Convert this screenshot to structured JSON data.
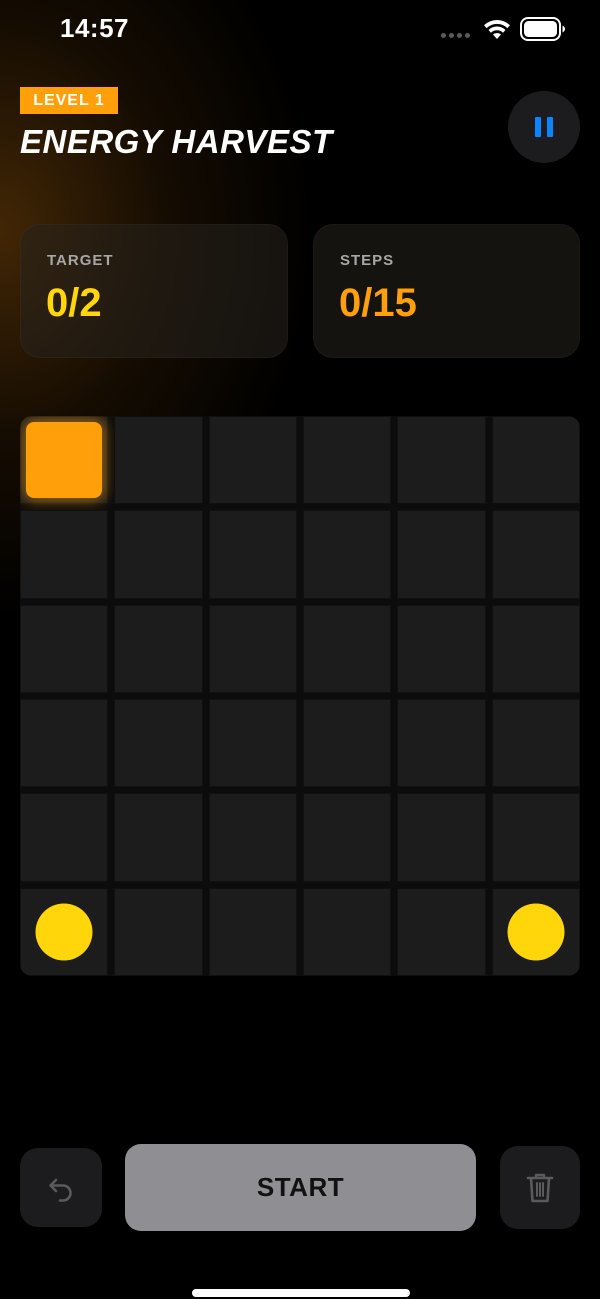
{
  "status_bar": {
    "time": "14:57",
    "icons": [
      "signal-dots-icon",
      "wifi-icon",
      "battery-icon"
    ]
  },
  "header": {
    "level_badge": "LEVEL 1",
    "title": "ENERGY HARVEST",
    "pause_icon": "pause-icon"
  },
  "stats": {
    "target": {
      "label": "TARGET",
      "value": "0/2"
    },
    "steps": {
      "label": "STEPS",
      "value": "0/15"
    }
  },
  "board": {
    "rows": 6,
    "cols": 6,
    "player_piece": {
      "row": 0,
      "col": 0
    },
    "energy_orbs": [
      {
        "row": 5,
        "col": 0
      },
      {
        "row": 5,
        "col": 5
      }
    ]
  },
  "controls": {
    "undo_icon": "undo-icon",
    "start_label": "START",
    "delete_icon": "trash-icon"
  },
  "colors": {
    "accent_orange": "#ff9f0a",
    "accent_yellow": "#ffd60a",
    "pause_blue": "#0a84ff",
    "start_button_gray": "#8e8e93"
  }
}
